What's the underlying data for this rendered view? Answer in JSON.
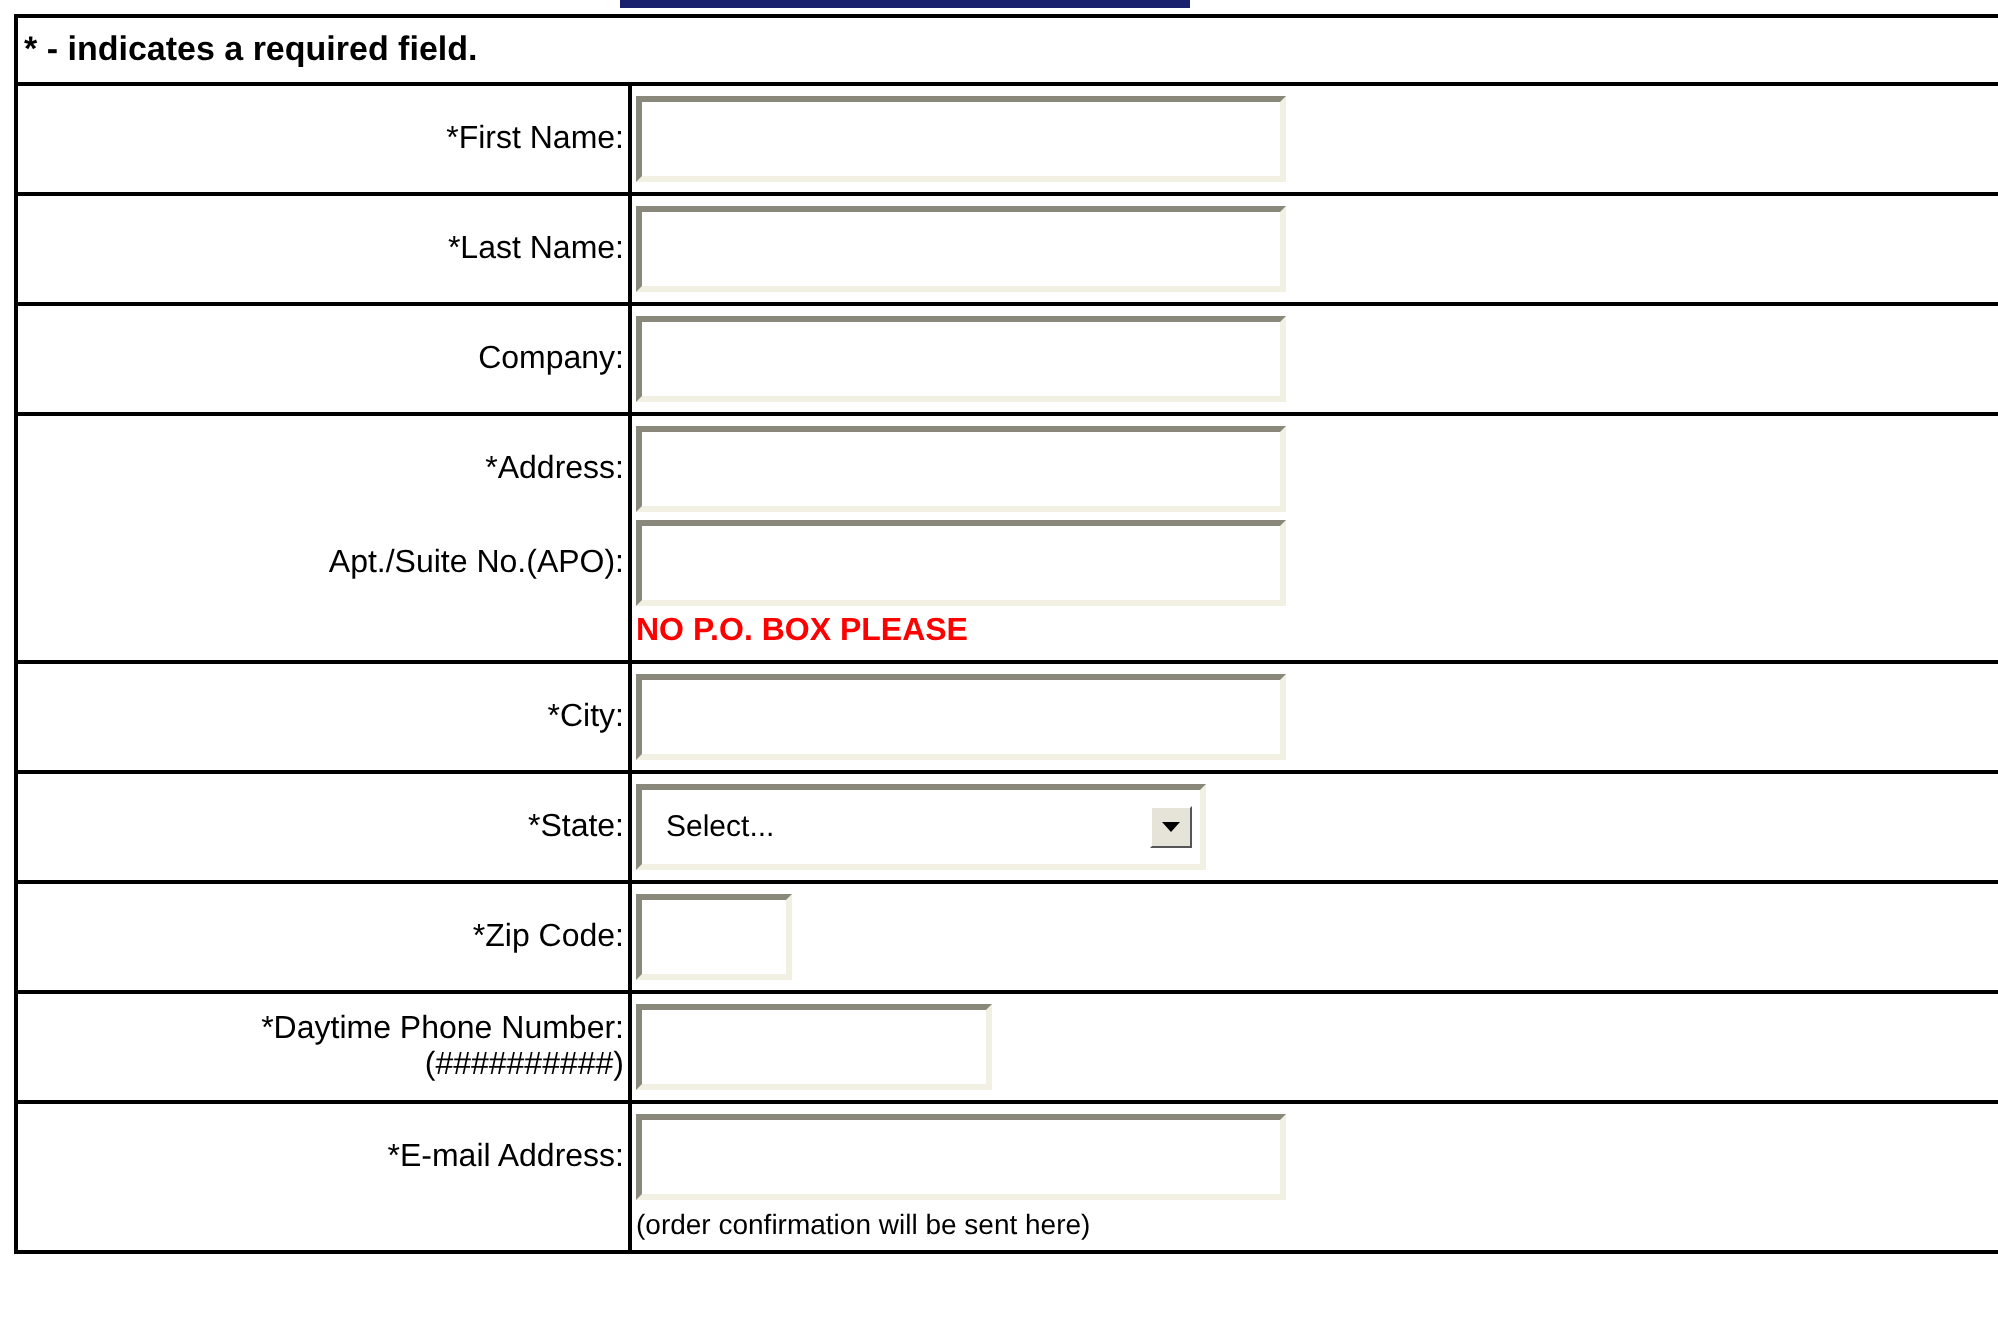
{
  "form": {
    "instructions": "* - indicates a required field.",
    "rows": [
      {
        "fields": [
          {
            "label": "*First Name:",
            "kind": "long"
          }
        ]
      },
      {
        "fields": [
          {
            "label": "*Last Name:",
            "kind": "long"
          }
        ]
      },
      {
        "fields": [
          {
            "label": "Company:",
            "kind": "long"
          }
        ]
      },
      {
        "fields": [
          {
            "label": "*Address:",
            "kind": "long"
          },
          {
            "label": "Apt./Suite No.(APO):",
            "kind": "long"
          }
        ],
        "note": {
          "text": "NO P.O. BOX PLEASE",
          "kind": "warning"
        }
      },
      {
        "fields": [
          {
            "label": "*City:",
            "kind": "long"
          }
        ]
      },
      {
        "fields": [
          {
            "label": "*State:",
            "kind": "select",
            "value": "Select..."
          }
        ]
      },
      {
        "fields": [
          {
            "label": "*Zip Code:",
            "kind": "short"
          }
        ]
      },
      {
        "fields": [
          {
            "label": "*Daytime Phone Number:",
            "label_note": "(##########)",
            "kind": "medium"
          }
        ]
      },
      {
        "fields": [
          {
            "label": "*E-mail Address:",
            "kind": "long"
          }
        ],
        "note": {
          "text": "(order confirmation will be sent here)",
          "kind": "hint"
        }
      }
    ]
  }
}
